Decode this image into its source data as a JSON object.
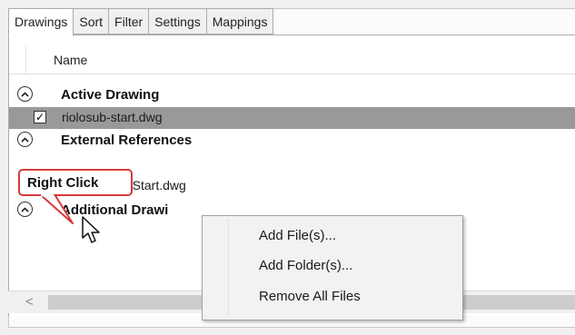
{
  "tabs": [
    "Drawings",
    "Sort",
    "Filter",
    "Settings",
    "Mappings"
  ],
  "header": {
    "name_column": "Name"
  },
  "groups": {
    "active": {
      "title": "Active Drawing"
    },
    "external": {
      "title": "External References"
    },
    "additional": {
      "title": "Additional Drawi"
    }
  },
  "files": {
    "active_file": {
      "name": "riolosub-start.dwg",
      "checked": "✓"
    },
    "xref_file": {
      "name": "-Start.dwg"
    }
  },
  "callout": {
    "label": "Right Click"
  },
  "context_menu": {
    "items": [
      "Add File(s)...",
      "Add Folder(s)...",
      "Remove All Files"
    ]
  },
  "scrollbar": {
    "left_arrow": "<"
  },
  "colors": {
    "selected_row": "#999999",
    "callout_border": "#d63a3a",
    "menu_background": "#f2f2f2"
  }
}
